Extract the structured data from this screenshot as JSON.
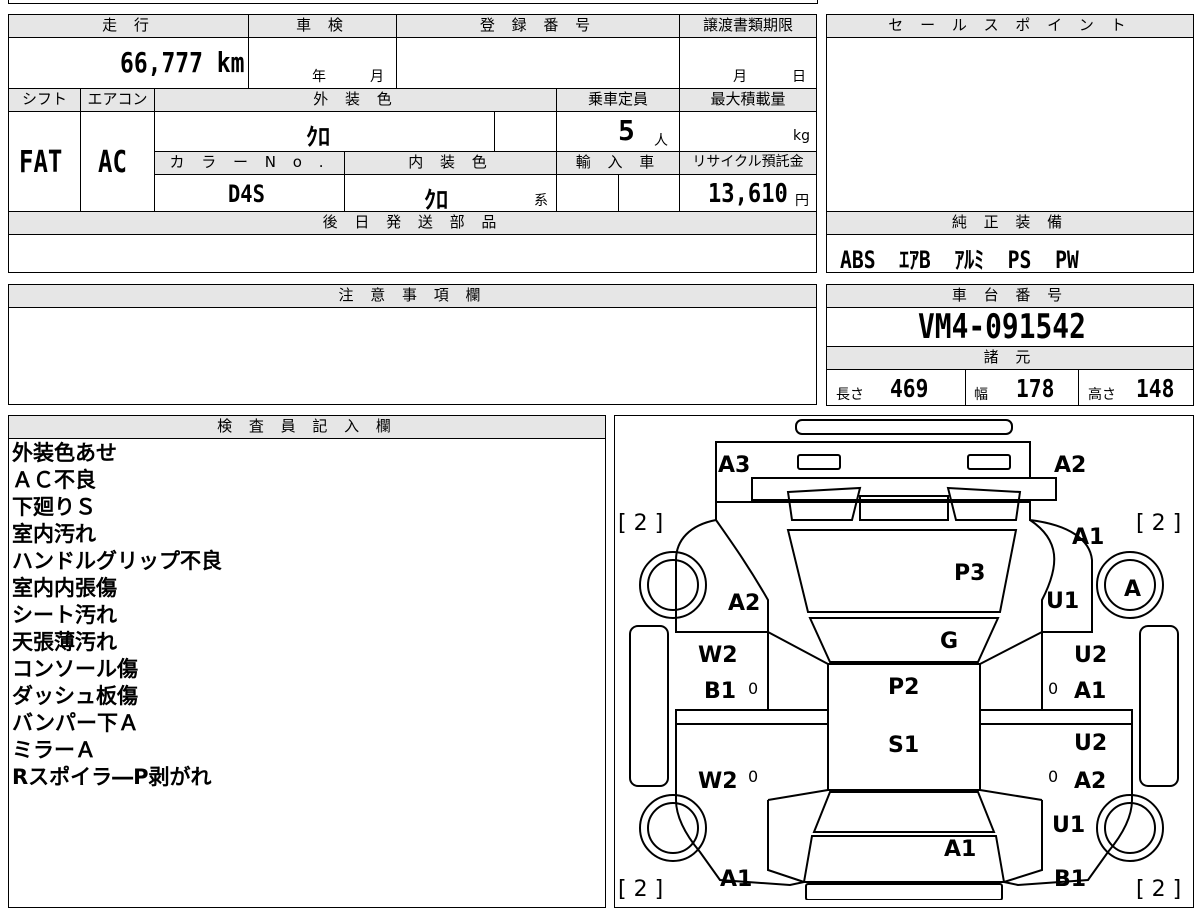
{
  "headers": {
    "mileage": "走 行",
    "inspection": "車 検",
    "registration": "登 録 番 号",
    "transfer_deadline": "譲渡書類期限",
    "sales_point": "セ ー ル ス ポ イ ン ト",
    "shift": "シフト",
    "aircon": "エアコン",
    "exterior_color": "外 装 色",
    "capacity": "乗車定員",
    "max_load": "最大積載量",
    "color_no": "カ ラ ー N o .",
    "interior_color": "内 装 色",
    "import": "輸 入 車",
    "recycle": "リサイクル預託金",
    "later_parts": "後 日 発 送 部 品",
    "genuine_equipment": "純 正 装 備",
    "notes": "注 意 事 項 欄",
    "chassis_no": "車 台 番 号",
    "specs": "諸 元",
    "inspector": "検 査 員 記 入 欄"
  },
  "values": {
    "mileage": "66,777 km",
    "year_unit": "年",
    "month_unit": "月",
    "deadline_month": "月",
    "deadline_day": "日",
    "shift": "FAT",
    "aircon": "AC",
    "exterior_color": "ｸﾛ",
    "capacity": "5",
    "capacity_unit": "人",
    "load_unit": "kg",
    "color_no": "D4S",
    "interior_color": "ｸﾛ",
    "interior_suffix": "系",
    "recycle": "13,610",
    "recycle_unit": "円",
    "genuine_equipment": "ABS  ｴｱB  ｱﾙﾐ  PS  PW",
    "chassis_no": "VM4-091542",
    "length_label": "長さ",
    "length": "469",
    "width_label": "幅",
    "width": "178",
    "height_label": "高さ",
    "height": "148"
  },
  "inspector_notes": [
    "外装色あせ",
    "ＡＣ不良",
    "下廻りＳ",
    "室内汚れ",
    "ハンドルグリップ不良",
    "室内内張傷",
    "シート汚れ",
    "天張薄汚れ",
    "コンソール傷",
    "ダッシュ板傷",
    "バンパー下Ａ",
    "ミラーＡ",
    "Rスポイラ―P剥がれ"
  ],
  "diagram": {
    "front_left": "A3",
    "front_right": "A2",
    "tire_fl": "[ 2 ]",
    "tire_fr": "[ 2 ]",
    "tire_rl": "[ 2 ]",
    "tire_rr": "[ 2 ]",
    "fender_left": "A2",
    "fender_right_a": "A1",
    "fender_right_b": "U1",
    "wheel_right_mark": "A",
    "hood": "P3",
    "windshield": "G",
    "roof": "P2",
    "roof_rear": "S1",
    "door_fl_a": "W2",
    "door_fl_b": "B1",
    "door_rl": "W2",
    "door_fr_a": "U2",
    "door_fr_b": "A1",
    "door_rr_a": "U2",
    "door_rr_b": "A2",
    "quarter_right": "U1",
    "rear_left": "A1",
    "trunk": "A1",
    "rear_right": "B1",
    "zero": "0"
  }
}
